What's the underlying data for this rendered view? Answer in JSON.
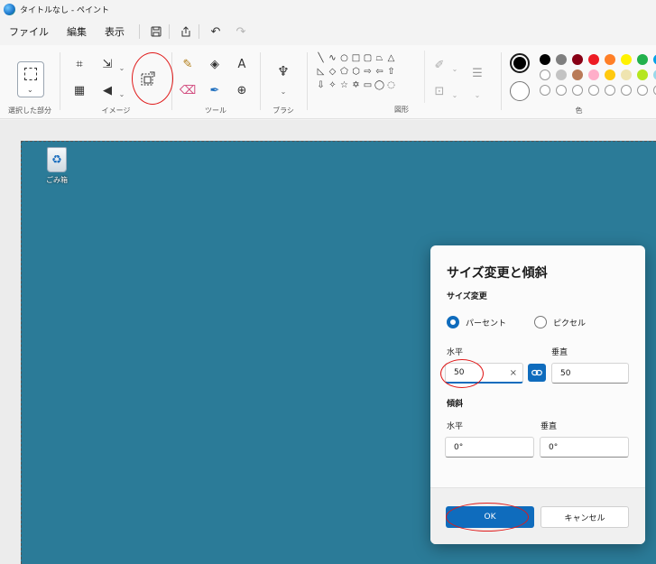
{
  "window": {
    "title": "タイトルなし - ペイント"
  },
  "menu": {
    "items": [
      "ファイル",
      "編集",
      "表示"
    ]
  },
  "quick_access": {
    "icons": [
      "save-icon",
      "share-icon",
      "undo-icon",
      "redo-icon"
    ]
  },
  "ribbon": {
    "groups": {
      "selection": "選択した部分",
      "image": "イメージ",
      "tools": "ツール",
      "brushes": "ブラシ",
      "shapes": "図形",
      "colors": "色"
    }
  },
  "colors": {
    "primary": "#000000",
    "secondary": "#ffffff",
    "palette_row1": [
      "#000000",
      "#7f7f7f",
      "#880015",
      "#ed1c24",
      "#ff7f27",
      "#fff200",
      "#22b14c",
      "#00a2e8"
    ],
    "palette_row2": [
      "#ffffff",
      "#c3c3c3",
      "#b97a57",
      "#ffaec9",
      "#ffc90e",
      "#efe4b0",
      "#b5e61d",
      "#99d9ea"
    ],
    "palette_row3": [
      "empty",
      "empty",
      "empty",
      "empty",
      "empty",
      "empty",
      "empty",
      "empty"
    ]
  },
  "desktop": {
    "recycle_label": "ごみ箱"
  },
  "dialog": {
    "title": "サイズ変更と傾斜",
    "resize": {
      "heading": "サイズ変更",
      "option_percent": "パーセント",
      "option_pixel": "ピクセル",
      "selected": "パーセント",
      "horizontal_label": "水平",
      "vertical_label": "垂直",
      "horizontal_value": "50",
      "vertical_value": "50",
      "clear_symbol": "×"
    },
    "skew": {
      "heading": "傾斜",
      "horizontal_label": "水平",
      "vertical_label": "垂直",
      "horizontal_value": "0°",
      "vertical_value": "0°"
    },
    "ok_label": "OK",
    "cancel_label": "キャンセル"
  },
  "annotations": {
    "highlight_color": "#e01a1a"
  }
}
